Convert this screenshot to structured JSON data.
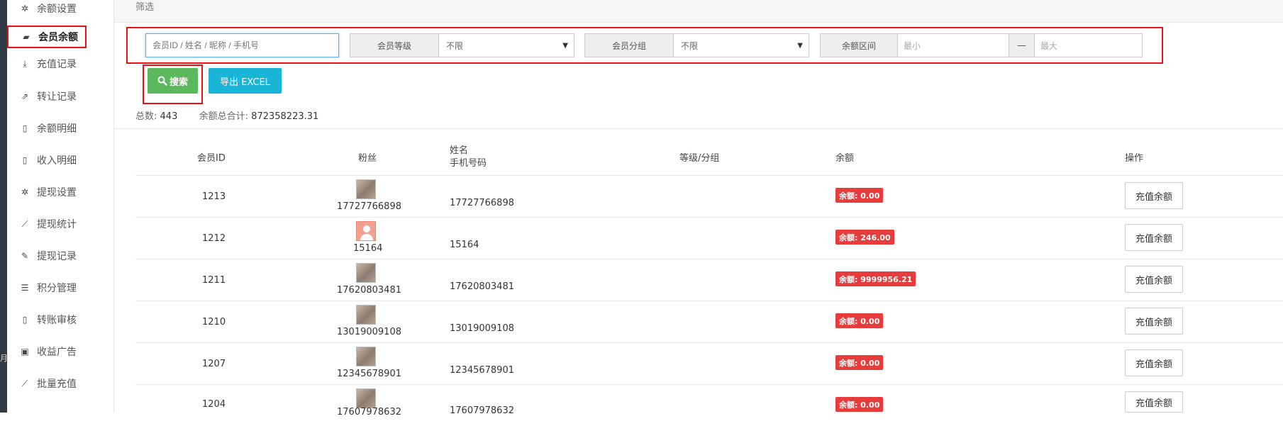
{
  "sidebar": {
    "items": [
      {
        "label": "余额设置",
        "icon": "gear-icon",
        "glyph": "✲"
      },
      {
        "label": "会员余额",
        "icon": "book-icon",
        "glyph": "▰",
        "active": true
      },
      {
        "label": "充值记录",
        "icon": "download-icon",
        "glyph": "⤓"
      },
      {
        "label": "转让记录",
        "icon": "external-link-icon",
        "glyph": "⇗"
      },
      {
        "label": "余额明细",
        "icon": "file-icon",
        "glyph": "▯"
      },
      {
        "label": "收入明细",
        "icon": "file-icon",
        "glyph": "▯"
      },
      {
        "label": "提现设置",
        "icon": "gear-icon",
        "glyph": "✲"
      },
      {
        "label": "提现统计",
        "icon": "line-chart-icon",
        "glyph": "⟋"
      },
      {
        "label": "提现记录",
        "icon": "pencil-icon",
        "glyph": "✎"
      },
      {
        "label": "积分管理",
        "icon": "database-icon",
        "glyph": "☰"
      },
      {
        "label": "转账审核",
        "icon": "file-icon",
        "glyph": "▯"
      },
      {
        "label": "收益广告",
        "icon": "image-icon",
        "glyph": "▣"
      },
      {
        "label": "批量充值",
        "icon": "line-chart-icon",
        "glyph": "⟋"
      }
    ]
  },
  "left_strip_mark": "月",
  "filter": {
    "title": "筛选",
    "search_placeholder": "会员ID / 姓名 / 昵称 / 手机号",
    "level_label": "会员等级",
    "level_value": "不限",
    "group_label": "会员分组",
    "group_value": "不限",
    "balance_label": "余额区间",
    "min_placeholder": "最小",
    "range_dash": "—",
    "max_placeholder": "最大"
  },
  "buttons": {
    "search": "搜索",
    "export": "导出 EXCEL"
  },
  "stats": {
    "total_label": "总数:",
    "total_value": "443",
    "sum_label": "余额总合计:",
    "sum_value": "872358223.31"
  },
  "table": {
    "headers": {
      "member_id": "会员ID",
      "fans": "粉丝",
      "name": "姓名",
      "phone": "手机号码",
      "level_group": "等级/分组",
      "balance": "余额",
      "actions": "操作"
    },
    "rows": [
      {
        "id": "1213",
        "fan": "17727766898",
        "phone": "17727766898",
        "balance": "余额: 0.00",
        "avatar": "photo"
      },
      {
        "id": "1212",
        "fan": "15164",
        "phone": "15164",
        "balance": "余额: 246.00",
        "avatar": "default"
      },
      {
        "id": "1211",
        "fan": "17620803481",
        "phone": "17620803481",
        "balance": "余额: 9999956.21",
        "avatar": "photo"
      },
      {
        "id": "1210",
        "fan": "13019009108",
        "phone": "13019009108",
        "balance": "余额: 0.00",
        "avatar": "photo"
      },
      {
        "id": "1207",
        "fan": "12345678901",
        "phone": "12345678901",
        "balance": "余额: 0.00",
        "avatar": "photo"
      },
      {
        "id": "1204",
        "fan": "17607978632",
        "phone": "17607978632",
        "balance": "余额: 0.00",
        "avatar": "photo"
      }
    ],
    "recharge_label": "充值余额"
  },
  "colors": {
    "accent_green": "#5cb85c",
    "accent_cyan": "#1ab5d6",
    "badge_red": "#e73c3c",
    "highlight_red": "#ee1111"
  }
}
